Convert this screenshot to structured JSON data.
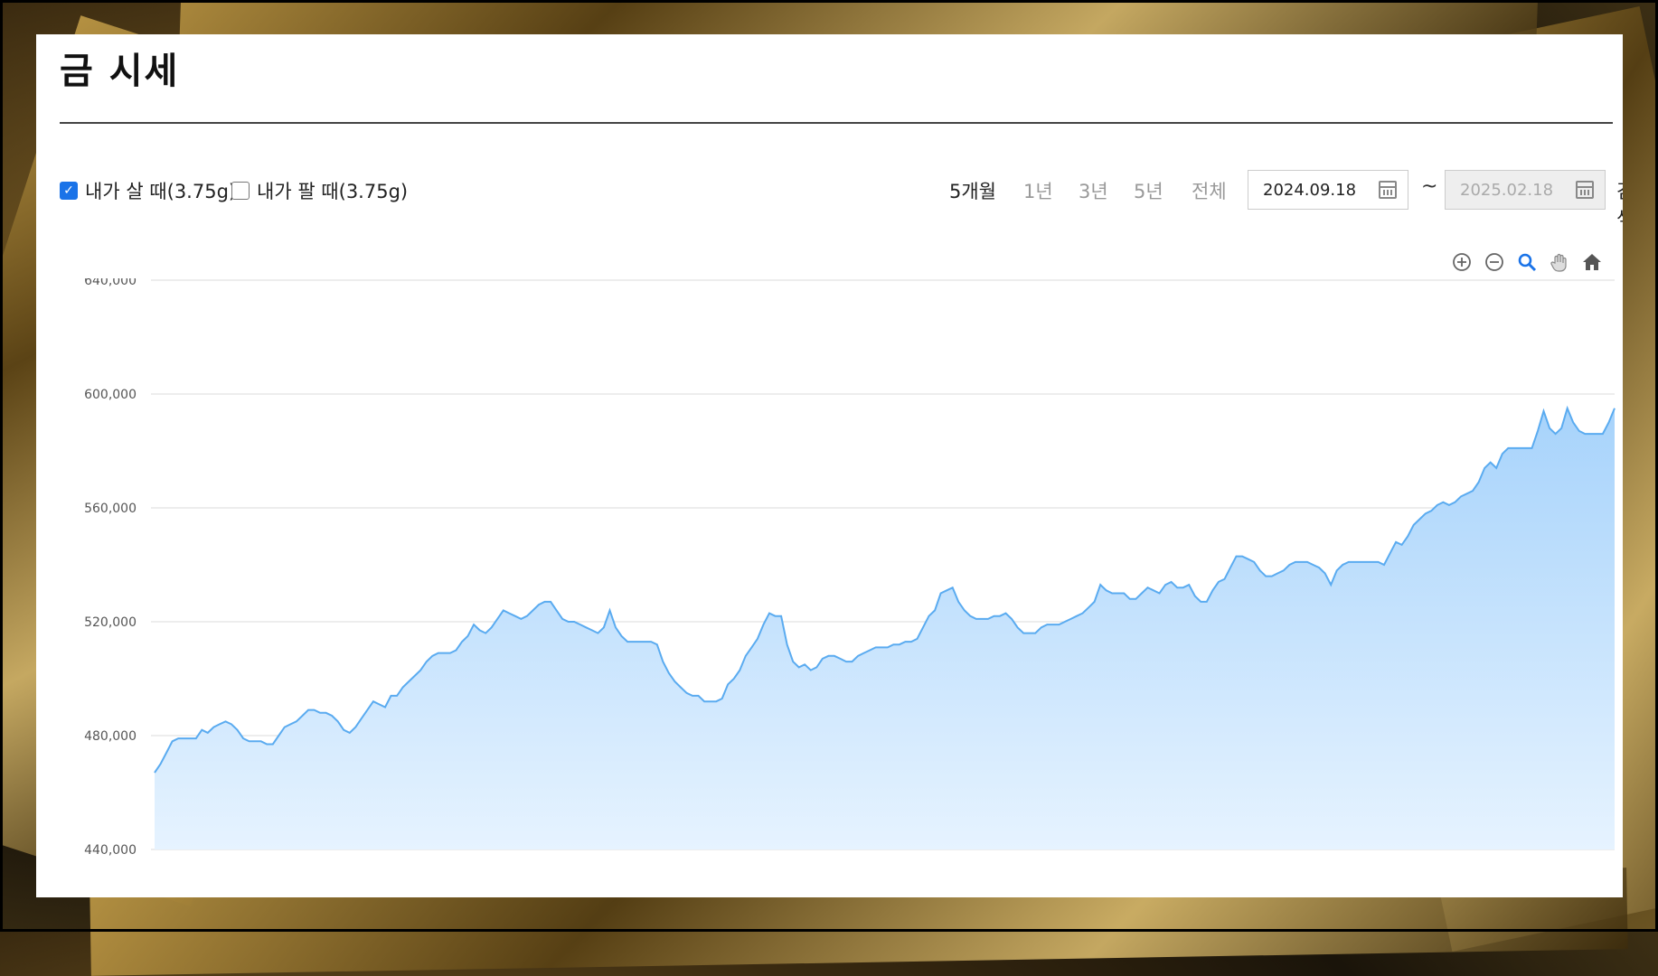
{
  "page": {
    "title": "금 시세"
  },
  "filters": {
    "buy_label": "내가 살 때(3.75g)",
    "buy_checked": true,
    "sell_label": "내가 팔 때(3.75g)",
    "sell_checked": false
  },
  "periods": [
    {
      "label": "5개월",
      "active": true
    },
    {
      "label": "1년",
      "active": false
    },
    {
      "label": "3년",
      "active": false
    },
    {
      "label": "5년",
      "active": false
    },
    {
      "label": "전체",
      "active": false
    }
  ],
  "date_range": {
    "start": "2024.09.18",
    "separator": "~",
    "end": "2025.02.18",
    "search_label": "검색"
  },
  "toolbar_icons": [
    "zoom-in-icon",
    "zoom-out-icon",
    "magnify-icon",
    "pan-hand-icon",
    "home-icon"
  ],
  "colors": {
    "line": "#5aabf0",
    "fill_top": "#a7d3fb",
    "fill_bottom": "#e6f3ff",
    "checkbox": "#1a73e8"
  },
  "chart_data": {
    "type": "area",
    "title": "",
    "xlabel": "",
    "ylabel": "",
    "ylim": [
      440000,
      640000
    ],
    "yticks": [
      "640,000",
      "600,000",
      "560,000",
      "520,000",
      "480,000",
      "440,000"
    ],
    "ytick_values": [
      640000,
      600000,
      560000,
      520000,
      480000,
      440000
    ],
    "grid": true,
    "x_range": [
      "2024.09.18",
      "2025.02.18"
    ],
    "series": [
      {
        "values": [
          467000,
          470000,
          474000,
          478000,
          479000,
          479000,
          479000,
          479000,
          482000,
          481000,
          483000,
          484000,
          485000,
          484000,
          482000,
          479000,
          478000,
          478000,
          478000,
          477000,
          477000,
          480000,
          483000,
          484000,
          485000,
          487000,
          489000,
          489000,
          488000,
          488000,
          487000,
          485000,
          482000,
          481000,
          483000,
          486000,
          489000,
          492000,
          491000,
          490000,
          494000,
          494000,
          497000,
          499000,
          501000,
          503000,
          506000,
          508000,
          509000,
          509000,
          509000,
          510000,
          513000,
          515000,
          519000,
          517000,
          516000,
          518000,
          521000,
          524000,
          523000,
          522000,
          521000,
          522000,
          524000,
          526000,
          527000,
          527000,
          524000,
          521000,
          520000,
          520000,
          519000,
          518000,
          517000,
          516000,
          518000,
          524000,
          518000,
          515000,
          513000,
          513000,
          513000,
          513000,
          513000,
          512000,
          506000,
          502000,
          499000,
          497000,
          495000,
          494000,
          494000,
          492000,
          492000,
          492000,
          493000,
          498000,
          500000,
          503000,
          508000,
          511000,
          514000,
          519000,
          523000,
          522000,
          522000,
          512000,
          506000,
          504000,
          505000,
          503000,
          504000,
          507000,
          508000,
          508000,
          507000,
          506000,
          506000,
          508000,
          509000,
          510000,
          511000,
          511000,
          511000,
          512000,
          512000,
          513000,
          513000,
          514000,
          518000,
          522000,
          524000,
          530000,
          531000,
          532000,
          527000,
          524000,
          522000,
          521000,
          521000,
          521000,
          522000,
          522000,
          523000,
          521000,
          518000,
          516000,
          516000,
          516000,
          518000,
          519000,
          519000,
          519000,
          520000,
          521000,
          522000,
          523000,
          525000,
          527000,
          533000,
          531000,
          530000,
          530000,
          530000,
          528000,
          528000,
          530000,
          532000,
          531000,
          530000,
          533000,
          534000,
          532000,
          532000,
          533000,
          529000,
          527000,
          527000,
          531000,
          534000,
          535000,
          539000,
          543000,
          543000,
          542000,
          541000,
          538000,
          536000,
          536000,
          537000,
          538000,
          540000,
          541000,
          541000,
          541000,
          540000,
          539000,
          537000,
          533000,
          538000,
          540000,
          541000,
          541000,
          541000,
          541000,
          541000,
          541000,
          540000,
          544000,
          548000,
          547000,
          550000,
          554000,
          556000,
          558000,
          559000,
          561000,
          562000,
          561000,
          562000,
          564000,
          565000,
          566000,
          569000,
          574000,
          576000,
          574000,
          579000,
          581000,
          581000,
          581000,
          581000,
          581000,
          587000,
          594000,
          588000,
          586000,
          588000,
          595000,
          590000,
          587000,
          586000,
          586000,
          586000,
          586000,
          590000,
          595000
        ]
      }
    ]
  }
}
